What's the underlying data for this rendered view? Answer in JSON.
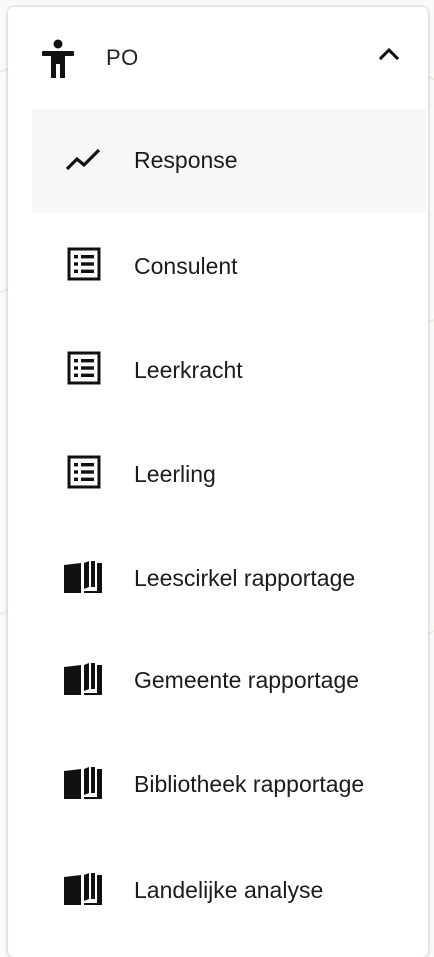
{
  "group": {
    "label": "PO",
    "icon": "accessibility-person-icon",
    "expanded": true,
    "toggle_icon": "chevron-up-icon"
  },
  "items": [
    {
      "label": "Response",
      "icon": "trending-line-icon",
      "active": true
    },
    {
      "label": "Consulent",
      "icon": "list-document-icon",
      "active": false
    },
    {
      "label": "Leerkracht",
      "icon": "list-document-icon",
      "active": false
    },
    {
      "label": "Leerling",
      "icon": "list-document-icon",
      "active": false
    },
    {
      "label": "Leescirkel rapportage",
      "icon": "open-book-icon",
      "active": false
    },
    {
      "label": "Gemeente rapportage",
      "icon": "open-book-icon",
      "active": false
    },
    {
      "label": "Bibliotheek rapportage",
      "icon": "open-book-icon",
      "active": false
    },
    {
      "label": "Landelijke analyse",
      "icon": "open-book-icon",
      "active": false
    }
  ],
  "colors": {
    "active_background": "#f7f7f7",
    "text": "#1b1b1b",
    "icon": "#111111"
  }
}
